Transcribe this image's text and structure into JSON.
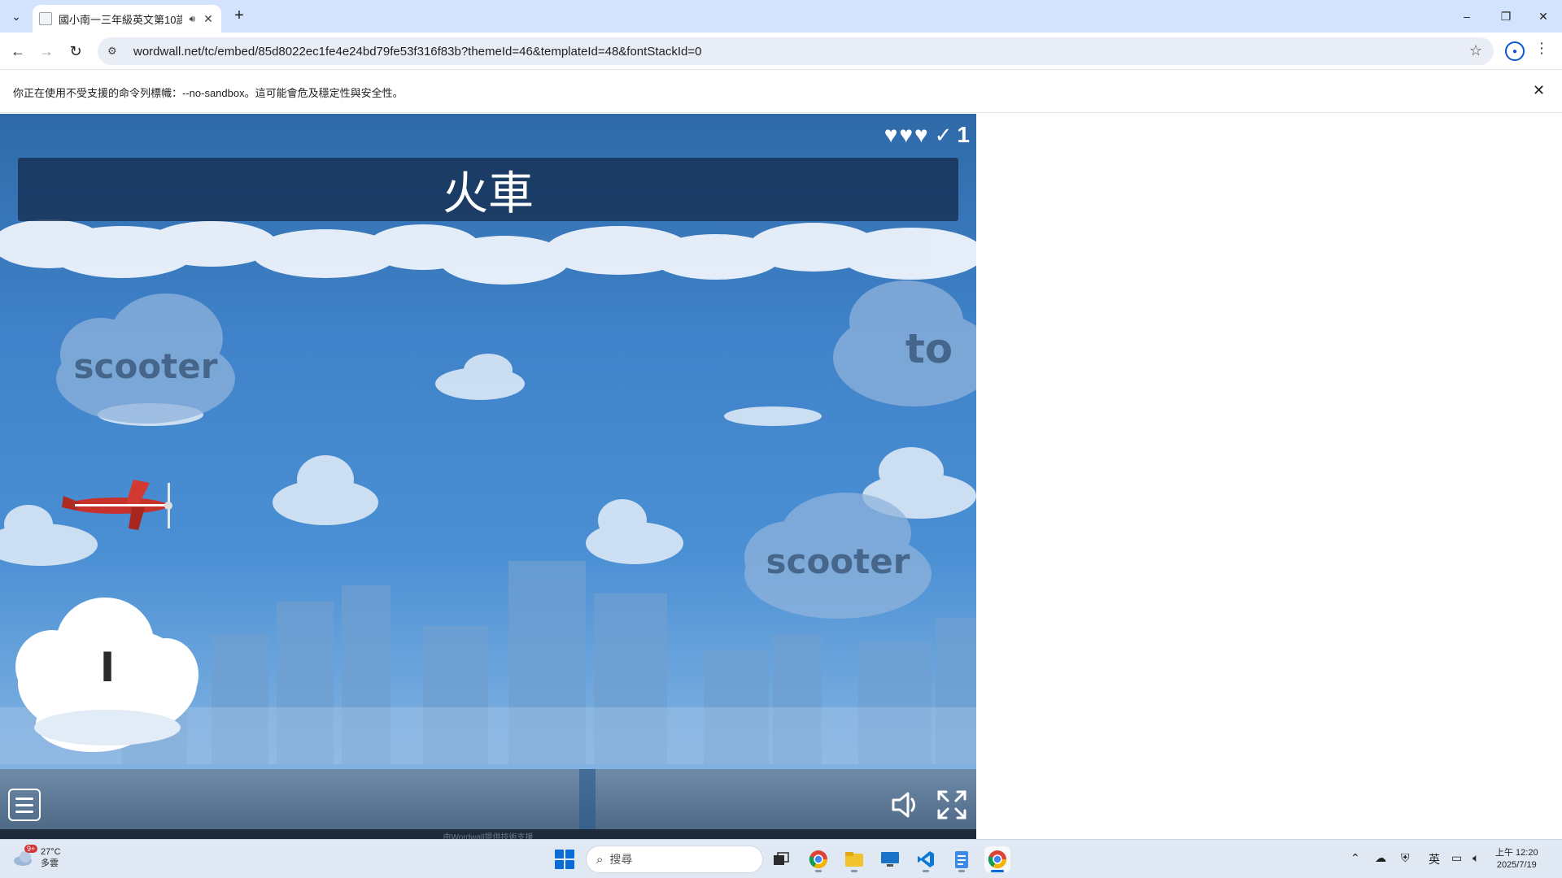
{
  "browser": {
    "tab": {
      "title": "國小南一三年級英文第10課",
      "audio_icon": "speaker-icon",
      "close_icon": "close-icon"
    },
    "new_tab_label": "+",
    "window_controls": {
      "minimize": "–",
      "restore": "❐",
      "close": "✕"
    },
    "address": {
      "url": "wordwall.net/tc/embed/85d8022ec1fe4e24bd79fe53f316f83b?themeId=46&templateId=48&fontStackId=0"
    },
    "infobar": {
      "message": "你正在使用不受支援的命令列標幟：--no-sandbox。這可能會危及穩定性與安全性。",
      "close": "✕"
    }
  },
  "game": {
    "question": "火車",
    "lives": 3,
    "score": "1",
    "answers": [
      {
        "label": "scooter"
      },
      {
        "label": "to"
      },
      {
        "label": "scooter"
      }
    ],
    "player_letter": "I",
    "footer": "由Wordwall提供技術支援"
  },
  "taskbar": {
    "weather": {
      "temp": "27°C",
      "condition": "多雲",
      "badge": "9+"
    },
    "search_placeholder": "搜尋",
    "apps": [
      "task-view-icon",
      "chrome-icon",
      "file-explorer-icon",
      "remote-desktop-icon",
      "vscode-icon",
      "notepad-icon",
      "chrome-active-icon"
    ],
    "tray": {
      "ime": "英"
    },
    "clock": {
      "time": "上午 12:20",
      "date": "2025/7/19"
    }
  },
  "colors": {
    "sky": "#4a8fd4",
    "question_bar": "#142d50",
    "accent": "#0a6cd6"
  }
}
